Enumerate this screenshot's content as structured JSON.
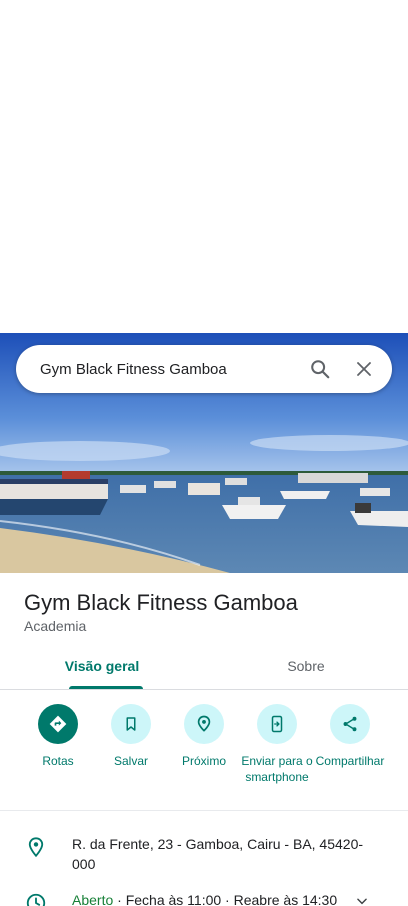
{
  "search": {
    "query": "Gym Black Fitness Gamboa"
  },
  "place": {
    "name": "Gym Black Fitness Gamboa",
    "category": "Academia"
  },
  "tabs": [
    {
      "label": "Visão geral",
      "active": true
    },
    {
      "label": "Sobre",
      "active": false
    }
  ],
  "actions": [
    {
      "label": "Rotas",
      "icon": "directions-icon"
    },
    {
      "label": "Salvar",
      "icon": "bookmark-icon"
    },
    {
      "label": "Próximo",
      "icon": "nearby-icon"
    },
    {
      "label": "Enviar para o smartphone",
      "icon": "send-to-phone-icon"
    },
    {
      "label": "Compartilhar",
      "icon": "share-icon"
    }
  ],
  "info": {
    "address": "R. da Frente, 23 - Gamboa, Cairu - BA, 45420-000",
    "hours_status": "Aberto",
    "hours_detail": " · Fecha às 11:00 · Reabre às 14:30"
  },
  "colors": {
    "accent": "#00796b",
    "action_bg": "#cdf6f9",
    "open": "#188038"
  }
}
